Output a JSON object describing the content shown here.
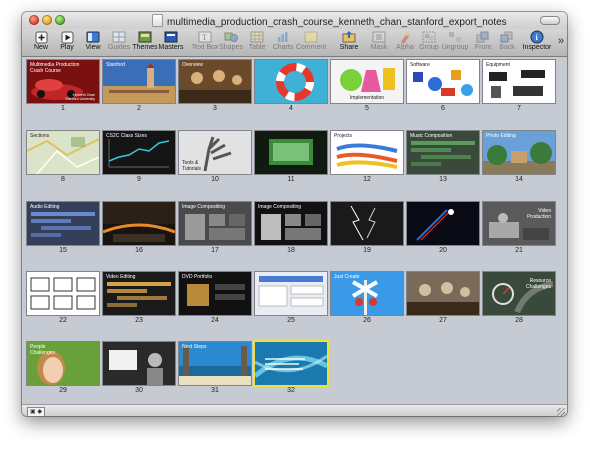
{
  "window": {
    "title": "multimedia_production_crash_course_kenneth_chan_stanford_export_notes"
  },
  "toolbar": {
    "items": [
      {
        "id": "new",
        "label": "New",
        "icon": "plus-icon",
        "enabled": true
      },
      {
        "id": "play",
        "label": "Play",
        "icon": "play-icon",
        "enabled": true
      },
      {
        "id": "view",
        "label": "View",
        "icon": "view-icon",
        "enabled": true
      },
      {
        "id": "guides",
        "label": "Guides",
        "icon": "guides-icon",
        "enabled": false
      },
      {
        "id": "themes",
        "label": "Themes",
        "icon": "themes-icon",
        "enabled": true
      },
      {
        "id": "masters",
        "label": "Masters",
        "icon": "masters-icon",
        "enabled": true
      },
      {
        "id": "textbox",
        "label": "Text Box",
        "icon": "textbox-icon",
        "enabled": false
      },
      {
        "id": "shapes",
        "label": "Shapes",
        "icon": "shapes-icon",
        "enabled": false
      },
      {
        "id": "table",
        "label": "Table",
        "icon": "table-icon",
        "enabled": false
      },
      {
        "id": "charts",
        "label": "Charts",
        "icon": "charts-icon",
        "enabled": false
      },
      {
        "id": "comment",
        "label": "Comment",
        "icon": "comment-icon",
        "enabled": false
      },
      {
        "id": "share",
        "label": "Share",
        "icon": "share-icon",
        "enabled": true
      },
      {
        "id": "mask",
        "label": "Mask",
        "icon": "mask-icon",
        "enabled": false
      },
      {
        "id": "alpha",
        "label": "Alpha",
        "icon": "alpha-icon",
        "enabled": false
      },
      {
        "id": "group",
        "label": "Group",
        "icon": "group-icon",
        "enabled": false
      },
      {
        "id": "ungroup",
        "label": "Ungroup",
        "icon": "ungroup-icon",
        "enabled": false
      },
      {
        "id": "front",
        "label": "Front",
        "icon": "front-icon",
        "enabled": false
      },
      {
        "id": "back",
        "label": "Back",
        "icon": "back-icon",
        "enabled": false
      },
      {
        "id": "inspector",
        "label": "Inspector",
        "icon": "info-icon",
        "enabled": true
      }
    ],
    "overflow": "»"
  },
  "slides": [
    {
      "num": "1",
      "title": "Multimedia Production\nCrash Course",
      "sub": "Kenneth Chan\nStanford University",
      "bg": "#7a1010",
      "accent": "#c02626",
      "scene": "car"
    },
    {
      "num": "2",
      "title": "Stanford",
      "bg": "#3a6fb8",
      "accent": "#c49a5a",
      "scene": "building"
    },
    {
      "num": "3",
      "title": "Overview",
      "bg": "#6a4a2a",
      "accent": "#d9b07a",
      "scene": "people"
    },
    {
      "num": "4",
      "title": "",
      "bg": "#3fb1d6",
      "accent": "#e8372a",
      "scene": "ring"
    },
    {
      "num": "5",
      "title": "Implementation",
      "bg": "#f4f4f4",
      "accent": "#7ad03a",
      "scene": "flasks",
      "dark": true
    },
    {
      "num": "6",
      "title": "Software",
      "bg": "#ffffff",
      "accent": "#2b6fd6",
      "scene": "software",
      "dark": true
    },
    {
      "num": "7",
      "title": "Equipment",
      "bg": "#ffffff",
      "accent": "#222222",
      "scene": "equipment",
      "dark": true
    },
    {
      "num": "8",
      "title": "Sections",
      "bg": "#dbe3c8",
      "accent": "#7aa35a",
      "scene": "map",
      "dark": true
    },
    {
      "num": "9",
      "title": "CS2C Class Sizes",
      "bg": "#151515",
      "accent": "#37c8d8",
      "scene": "chart"
    },
    {
      "num": "10",
      "title": "Tools &\nTutorials",
      "bg": "#e2e2e2",
      "accent": "#555555",
      "scene": "hand",
      "dark": true
    },
    {
      "num": "11",
      "title": "",
      "bg": "#101a10",
      "accent": "#3a8a3a",
      "scene": "screen"
    },
    {
      "num": "12",
      "title": "Projects",
      "bg": "#ffffff",
      "accent": "#e85a2a",
      "scene": "paint",
      "dark": true
    },
    {
      "num": "13",
      "title": "Music Composition",
      "bg": "#3a4a3a",
      "accent": "#5a9a5a",
      "scene": "daw"
    },
    {
      "num": "14",
      "title": "Photo Editing",
      "bg": "#6aa0d8",
      "accent": "#3a7a3a",
      "scene": "trees"
    },
    {
      "num": "15",
      "title": "Audio Editing",
      "bg": "#34405a",
      "accent": "#6a8ad0",
      "scene": "daw"
    },
    {
      "num": "16",
      "title": "",
      "bg": "#1a1410",
      "accent": "#e88a2a",
      "scene": "plane"
    },
    {
      "num": "17",
      "title": "Image Compositing",
      "bg": "#4a4a4a",
      "accent": "#9a9a9a",
      "scene": "composite"
    },
    {
      "num": "18",
      "title": "Image Compositing",
      "bg": "#111111",
      "accent": "#bdbdbd",
      "scene": "composite"
    },
    {
      "num": "19",
      "title": "",
      "bg": "#1a1a1a",
      "accent": "#cfcfcf",
      "scene": "lightning"
    },
    {
      "num": "20",
      "title": "",
      "bg": "#0a0a14",
      "accent": "#2a6ad8",
      "scene": "laser"
    },
    {
      "num": "21",
      "title": "Video\nProduction",
      "bg": "#5a5a5a",
      "accent": "#dcdcdc",
      "scene": "studio"
    },
    {
      "num": "22",
      "title": "",
      "bg": "#ffffff",
      "accent": "#333333",
      "scene": "storyboard",
      "dark": true
    },
    {
      "num": "23",
      "title": "Video Editing",
      "bg": "#1a1a1a",
      "accent": "#d8a24a",
      "scene": "daw"
    },
    {
      "num": "24",
      "title": "DVD Portfolio",
      "bg": "#111111",
      "accent": "#b88a3a",
      "scene": "dvd"
    },
    {
      "num": "25",
      "title": "",
      "bg": "#e8ecf4",
      "accent": "#4a7ad0",
      "scene": "webpage",
      "dark": true
    },
    {
      "num": "26",
      "title": "Just Create",
      "bg": "#3a9ae8",
      "accent": "#d83a2a",
      "scene": "crossing"
    },
    {
      "num": "27",
      "title": "",
      "bg": "#7a6a5a",
      "accent": "#d0c0a0",
      "scene": "people"
    },
    {
      "num": "28",
      "title": "Resource\nChallenges",
      "bg": "#3a4a3a",
      "accent": "#e0e0e0",
      "scene": "gauge"
    },
    {
      "num": "29",
      "title": "People\nChallenges",
      "bg": "#6aa03a",
      "accent": "#f0d0b0",
      "scene": "girl"
    },
    {
      "num": "30",
      "title": "",
      "bg": "#2a2a2a",
      "accent": "#f0f0f0",
      "scene": "lecture"
    },
    {
      "num": "31",
      "title": "Next Steps",
      "bg": "#2a8ad0",
      "accent": "#e8e0c0",
      "scene": "beach"
    },
    {
      "num": "32",
      "title": "",
      "bg": "#1a7ab0",
      "accent": "#7ad8e8",
      "scene": "swirl",
      "selected": true
    }
  ],
  "statusbar": {
    "view_button": "▣ ◆"
  }
}
